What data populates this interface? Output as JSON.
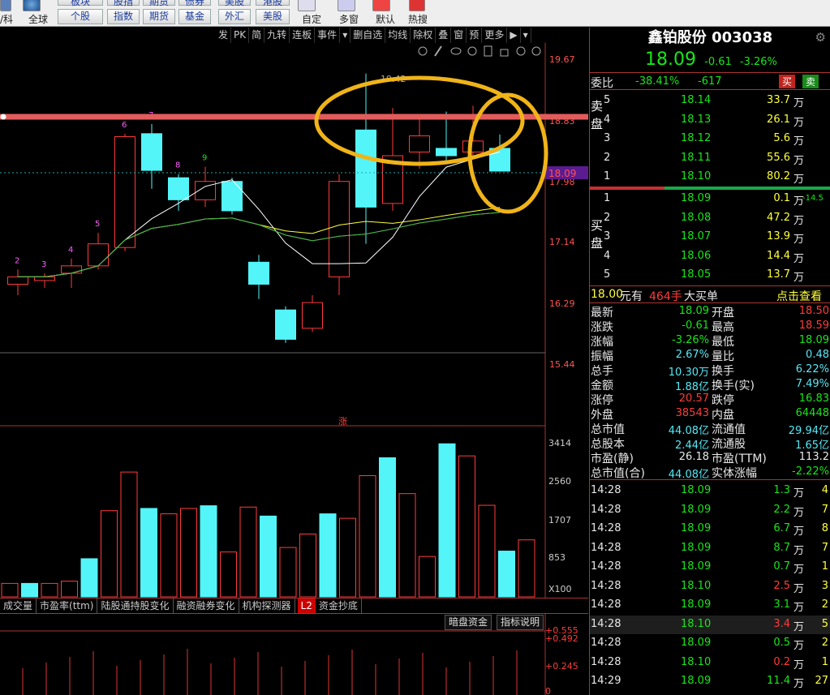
{
  "top": {
    "clip_buttons": [
      "板块",
      "股指",
      "期货",
      "债券",
      "美股",
      "港股"
    ],
    "buttons": [
      "个股",
      "指数",
      "期货",
      "基金",
      "外汇",
      "美股"
    ],
    "labels": [
      "/科",
      "全球",
      "自定",
      "多窗",
      "默认",
      "热搜"
    ]
  },
  "toolbar2": [
    "发",
    "PK",
    "简",
    "九转",
    "连板",
    "事件",
    "▾",
    "删自选",
    "均线",
    "除权",
    "叠",
    "窗",
    "预",
    "更多",
    "▶",
    "▾"
  ],
  "chart": {
    "price_ticks": [
      "19.67",
      "18.83",
      "17.98",
      "17.14",
      "16.29",
      "15.44"
    ],
    "current_price": "18.09",
    "peak_label": "19.42",
    "count_labels": [
      "2",
      "3",
      "4",
      "5",
      "6",
      "7",
      "8",
      "9"
    ],
    "up_marker": "涨",
    "vol_ticks": [
      "3414",
      "2560",
      "1707",
      "853",
      "X100"
    ],
    "ind_ticks": [
      "+0.555",
      "+0.492",
      "+0.245",
      "0"
    ],
    "bottom_tabs": [
      "成交量",
      "市盈率(ttm)",
      "陆股通持股变化",
      "融资融券变化",
      "机构探测器",
      "L2",
      "资金抄底"
    ],
    "ind_tabs": [
      "暗盘资金",
      "指标说明"
    ]
  },
  "chart_data": {
    "type": "candlestick",
    "candles": [
      {
        "o": 16.55,
        "c": 16.65,
        "h": 16.75,
        "l": 16.4
      },
      {
        "o": 16.6,
        "c": 16.65,
        "h": 16.7,
        "l": 16.5
      },
      {
        "o": 16.7,
        "c": 16.8,
        "h": 16.9,
        "l": 16.5
      },
      {
        "o": 16.8,
        "c": 17.1,
        "h": 17.25,
        "l": 16.75
      },
      {
        "o": 17.05,
        "c": 18.56,
        "h": 18.6,
        "l": 17.0
      },
      {
        "o": 18.6,
        "c": 18.1,
        "h": 18.73,
        "l": 17.85
      },
      {
        "o": 18.0,
        "c": 17.7,
        "h": 18.05,
        "l": 17.55
      },
      {
        "o": 17.7,
        "c": 17.95,
        "h": 18.15,
        "l": 17.6
      },
      {
        "o": 17.95,
        "c": 17.55,
        "h": 18.0,
        "l": 17.5
      },
      {
        "o": 16.85,
        "c": 16.55,
        "h": 16.95,
        "l": 16.35
      },
      {
        "o": 16.2,
        "c": 15.8,
        "h": 16.25,
        "l": 15.75
      },
      {
        "o": 15.95,
        "c": 16.3,
        "h": 16.4,
        "l": 15.9
      },
      {
        "o": 16.65,
        "c": 17.95,
        "h": 18.05,
        "l": 16.4
      },
      {
        "o": 18.65,
        "c": 17.6,
        "h": 19.42,
        "l": 17.1
      },
      {
        "o": 17.65,
        "c": 18.3,
        "h": 18.95,
        "l": 17.55
      },
      {
        "o": 18.35,
        "c": 18.57,
        "h": 18.83,
        "l": 18.12
      },
      {
        "o": 18.4,
        "c": 18.3,
        "h": 18.9,
        "l": 18.2
      },
      {
        "o": 18.35,
        "c": 18.5,
        "h": 18.98,
        "l": 18.3
      },
      {
        "o": 18.4,
        "c": 18.09,
        "h": 18.59,
        "l": 18.09
      }
    ],
    "volumes": [
      3,
      3,
      3,
      3.5,
      8.5,
      19.2,
      27.8,
      19.7,
      18.5,
      19.7,
      20.3,
      10,
      20,
      18,
      11,
      14,
      18.5,
      17.5,
      27,
      31,
      23,
      9,
      34.1,
      31.4,
      20.4,
      10.2,
      12.7
    ]
  },
  "stock": {
    "name": "鑫铂股份",
    "code": "003038",
    "price": "18.09",
    "change": "-0.61",
    "pct": "-3.26%"
  },
  "weibi": {
    "label": "委比",
    "ratio": "-38.41%",
    "diff": "-617",
    "buy": "买",
    "sell": "卖"
  },
  "sell_label": "卖盘",
  "buy_label": "买盘",
  "asks": [
    {
      "n": "5",
      "p": "18.14",
      "v": "33.7万"
    },
    {
      "n": "4",
      "p": "18.13",
      "v": "26.1万"
    },
    {
      "n": "3",
      "p": "18.12",
      "v": "5.6万"
    },
    {
      "n": "2",
      "p": "18.11",
      "v": "55.6万"
    },
    {
      "n": "1",
      "p": "18.10",
      "v": "80.2万"
    }
  ],
  "bids": [
    {
      "n": "1",
      "p": "18.09",
      "v": "0.1万",
      "x": "-14.5"
    },
    {
      "n": "2",
      "p": "18.08",
      "v": "47.2万",
      "x": ""
    },
    {
      "n": "3",
      "p": "18.07",
      "v": "13.9万",
      "x": ""
    },
    {
      "n": "4",
      "p": "18.06",
      "v": "14.4万",
      "x": ""
    },
    {
      "n": "5",
      "p": "18.05",
      "v": "13.7万",
      "x": ""
    }
  ],
  "bigorder": {
    "price": "18.00",
    "unit": "元有",
    "qty": "464手",
    "label": "大买单",
    "link": "点击查看"
  },
  "stats": [
    [
      "最新",
      "18.09",
      "green",
      "开盘",
      "18.50",
      "red"
    ],
    [
      "涨跌",
      "-0.61",
      "green",
      "最高",
      "18.59",
      "red"
    ],
    [
      "涨幅",
      "-3.26%",
      "green",
      "最低",
      "18.09",
      "green"
    ],
    [
      "振幅",
      "2.67%",
      "cyan",
      "量比",
      "0.48",
      "cyan"
    ],
    [
      "总手",
      "10.30万",
      "cyan",
      "换手",
      "6.22%",
      "cyan"
    ],
    [
      "金额",
      "1.88亿",
      "cyan",
      "换手(实)",
      "7.49%",
      "cyan"
    ],
    [
      "涨停",
      "20.57",
      "red",
      "跌停",
      "16.83",
      "green"
    ],
    [
      "外盘",
      "38543",
      "red",
      "内盘",
      "64448",
      "green"
    ],
    [
      "总市值",
      "44.08亿",
      "cyan",
      "流通值",
      "29.94亿",
      "cyan"
    ],
    [
      "总股本",
      "2.44亿",
      "cyan",
      "流通股",
      "1.65亿",
      "cyan"
    ],
    [
      "市盈(静)",
      "26.18",
      "white",
      "市盈(TTM)",
      "113.2",
      "white"
    ],
    [
      "总市值(合)",
      "44.08亿",
      "cyan",
      "实体涨幅",
      "-2.22%",
      "green"
    ]
  ],
  "ticks": [
    {
      "t": "14:28",
      "p": "18.09",
      "pc": "green",
      "v": "1.3万",
      "vc": "green",
      "n": "4"
    },
    {
      "t": "14:28",
      "p": "18.09",
      "pc": "green",
      "v": "2.2万",
      "vc": "green",
      "n": "7"
    },
    {
      "t": "14:28",
      "p": "18.09",
      "pc": "green",
      "v": "6.7万",
      "vc": "green",
      "n": "8"
    },
    {
      "t": "14:28",
      "p": "18.09",
      "pc": "green",
      "v": "8.7万",
      "vc": "green",
      "n": "7"
    },
    {
      "t": "14:28",
      "p": "18.09",
      "pc": "green",
      "v": "0.7万",
      "vc": "green",
      "n": "1"
    },
    {
      "t": "14:28",
      "p": "18.10",
      "pc": "green",
      "v": "2.5万",
      "vc": "red",
      "n": "3"
    },
    {
      "t": "14:28",
      "p": "18.09",
      "pc": "green",
      "v": "3.1万",
      "vc": "green",
      "n": "2"
    },
    {
      "t": "14:28",
      "p": "18.10",
      "pc": "green",
      "v": "3.4万",
      "vc": "red",
      "n": "5"
    },
    {
      "t": "14:28",
      "p": "18.09",
      "pc": "green",
      "v": "0.5万",
      "vc": "green",
      "n": "2"
    },
    {
      "t": "14:28",
      "p": "18.10",
      "pc": "green",
      "v": "0.2万",
      "vc": "red",
      "n": "1"
    },
    {
      "t": "14:29",
      "p": "18.09",
      "pc": "green",
      "v": "11.4万",
      "vc": "green",
      "n": "27"
    }
  ]
}
